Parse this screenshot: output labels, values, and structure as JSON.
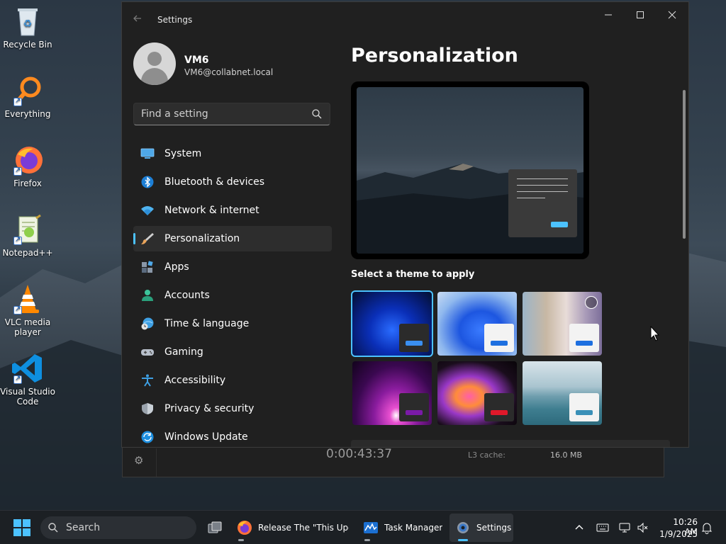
{
  "desktop": {
    "icons": [
      {
        "label": "Recycle Bin"
      },
      {
        "label": "Everything"
      },
      {
        "label": "Firefox"
      },
      {
        "label": "Notepad++"
      },
      {
        "label": "VLC media player"
      },
      {
        "label": "Visual Studio Code"
      }
    ]
  },
  "background_window": {
    "timer": "0:00:43:37",
    "l3_label": "L3 cache:",
    "l3_value": "16.0 MB"
  },
  "settings": {
    "title": "Settings",
    "user": {
      "name": "VM6",
      "email": "VM6@collabnet.local"
    },
    "search": {
      "placeholder": "Find a setting"
    },
    "nav": [
      {
        "label": "System",
        "icon": "monitor-icon"
      },
      {
        "label": "Bluetooth & devices",
        "icon": "bluetooth-icon"
      },
      {
        "label": "Network & internet",
        "icon": "wifi-icon"
      },
      {
        "label": "Personalization",
        "icon": "paintbrush-icon",
        "active": true
      },
      {
        "label": "Apps",
        "icon": "apps-icon"
      },
      {
        "label": "Accounts",
        "icon": "person-icon"
      },
      {
        "label": "Time & language",
        "icon": "globe-clock-icon"
      },
      {
        "label": "Gaming",
        "icon": "gamepad-icon"
      },
      {
        "label": "Accessibility",
        "icon": "accessibility-icon"
      },
      {
        "label": "Privacy & security",
        "icon": "shield-icon"
      },
      {
        "label": "Windows Update",
        "icon": "update-icon"
      }
    ],
    "page_title": "Personalization",
    "theme_section_label": "Select a theme to apply",
    "colors": {
      "accent": "#4cc2ff"
    }
  },
  "taskbar": {
    "search_label": "Search",
    "apps": [
      {
        "label": "Release The \"This Updat",
        "icon": "firefox-icon"
      },
      {
        "label": "Task Manager",
        "icon": "task-manager-icon"
      },
      {
        "label": "Settings",
        "icon": "settings-gear-icon",
        "active": true
      }
    ],
    "clock": {
      "time": "10:26 AM",
      "date": "1/9/2025"
    }
  }
}
